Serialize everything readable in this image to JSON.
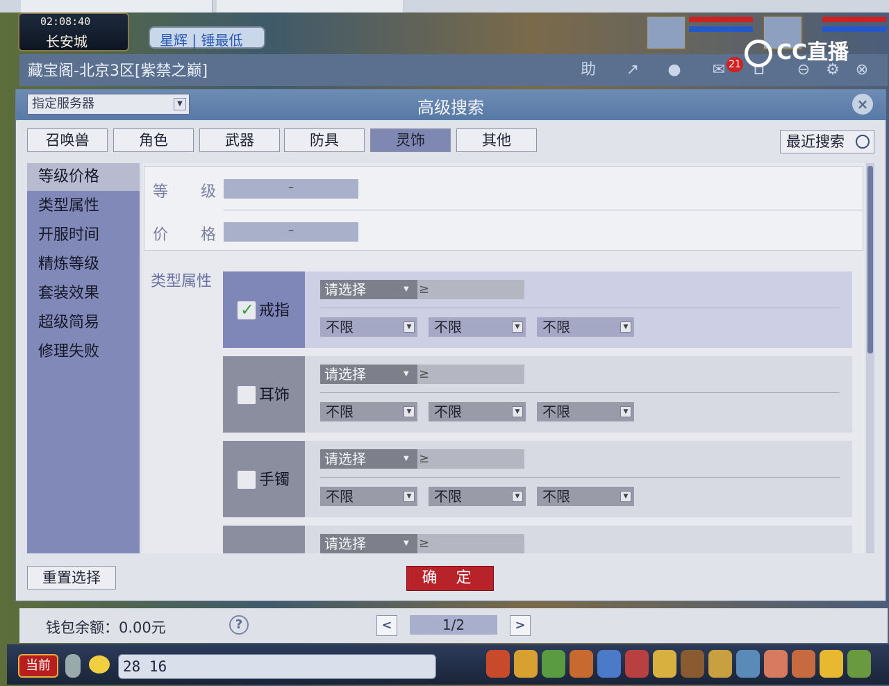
{
  "game": {
    "clock": "02:08:40",
    "location": "长安城",
    "server_badge": "星辉 | 锤最低"
  },
  "stream": {
    "logo": "CC直播"
  },
  "shell": {
    "title": "藏宝阁-北京3区[紫禁之巅]",
    "help_label": "助",
    "message_count": "21"
  },
  "dialog": {
    "server_select": "指定服务器",
    "title": "高级搜索",
    "close": "×",
    "tabs": [
      {
        "label": "召唤兽"
      },
      {
        "label": "角色"
      },
      {
        "label": "武器"
      },
      {
        "label": "防具"
      },
      {
        "label": "灵饰"
      },
      {
        "label": "其他"
      }
    ],
    "active_tab": "灵饰",
    "recent_search": "最近搜索",
    "nav": [
      {
        "label": "等级价格"
      },
      {
        "label": "类型属性"
      },
      {
        "label": "开服时间"
      },
      {
        "label": "精炼等级"
      },
      {
        "label": "套装效果"
      },
      {
        "label": "超级简易"
      },
      {
        "label": "修理失败"
      }
    ],
    "level_label": "等 级",
    "price_label": "价 格",
    "range_dash": "–",
    "type_section_label": "类型属性",
    "groups": [
      {
        "name": "戒指",
        "checked": true,
        "main_select": "请选择",
        "arrow": "≥",
        "filters": [
          "不限",
          "不限",
          "不限"
        ]
      },
      {
        "name": "耳饰",
        "checked": false,
        "main_select": "请选择",
        "arrow": "≥",
        "filters": [
          "不限",
          "不限",
          "不限"
        ]
      },
      {
        "name": "手镯",
        "checked": false,
        "main_select": "请选择",
        "arrow": "≥",
        "filters": [
          "不限",
          "不限",
          "不限"
        ]
      },
      {
        "name": "",
        "checked": false,
        "main_select": "请选择",
        "arrow": "≥",
        "filters": []
      }
    ],
    "reset_button": "重置选择",
    "confirm_button": "确 定"
  },
  "footer": {
    "wallet": "钱包余额：0.00元",
    "help": "?",
    "prev": "<",
    "page": "1/2",
    "next": ">"
  },
  "chatbar": {
    "channel": "当前",
    "input_value": "28  16"
  },
  "colors": {
    "active_tab": "#7f88b2",
    "nav_bg": "#8089b8",
    "confirm": "#b8232a",
    "title_bar": "#587aa6"
  }
}
